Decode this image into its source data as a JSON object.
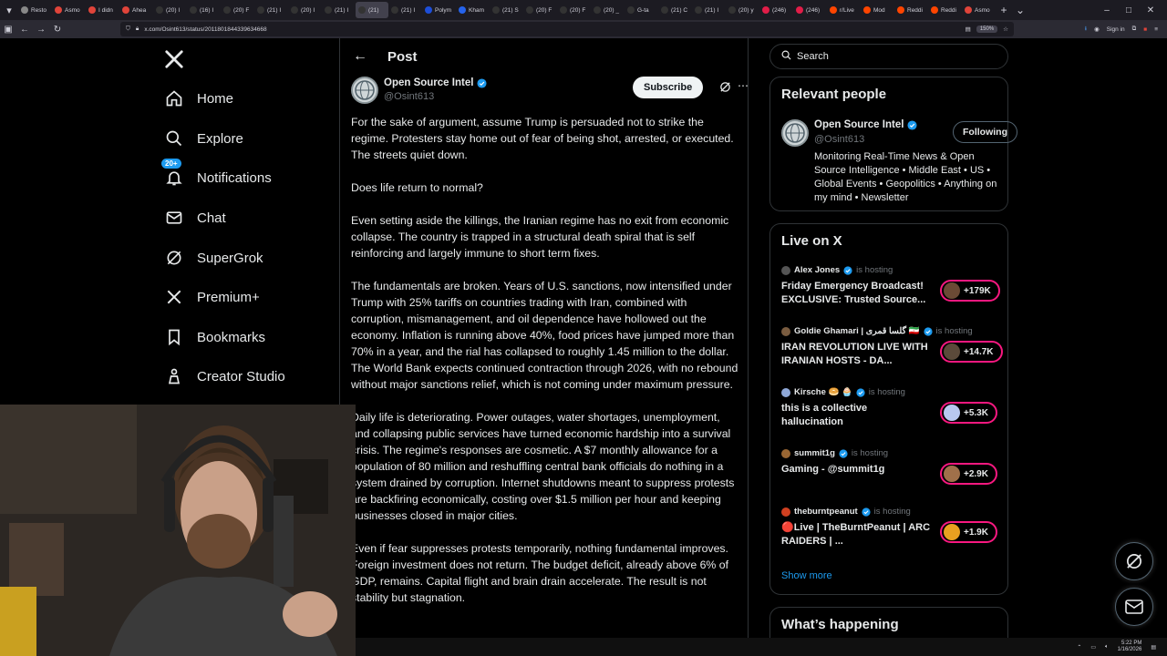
{
  "browser": {
    "tabs": [
      {
        "label": "Resto",
        "color": "#888888"
      },
      {
        "label": "Asmo",
        "color": "#e0443a"
      },
      {
        "label": "I didn",
        "color": "#e0443a"
      },
      {
        "label": "Ahea",
        "color": "#e0443a"
      },
      {
        "label": "(20) I",
        "color": "#333333"
      },
      {
        "label": "(16) I",
        "color": "#333333"
      },
      {
        "label": "(20) F",
        "color": "#333333"
      },
      {
        "label": "(21) I",
        "color": "#333333"
      },
      {
        "label": "(20) I",
        "color": "#333333"
      },
      {
        "label": "(21) I",
        "color": "#333333"
      },
      {
        "label": "(21)",
        "color": "#333333",
        "active": true
      },
      {
        "label": "(21) I",
        "color": "#333333"
      },
      {
        "label": "Polym",
        "color": "#1d4ed8"
      },
      {
        "label": "Kham",
        "color": "#2563eb"
      },
      {
        "label": "(21) S",
        "color": "#333333"
      },
      {
        "label": "(20) F",
        "color": "#333333"
      },
      {
        "label": "(20) F",
        "color": "#333333"
      },
      {
        "label": "(20) _",
        "color": "#333333"
      },
      {
        "label": "G-ta",
        "color": "#333333"
      },
      {
        "label": "(21) C",
        "color": "#333333"
      },
      {
        "label": "(21) I",
        "color": "#333333"
      },
      {
        "label": "(20) y",
        "color": "#333333"
      },
      {
        "label": "(246)",
        "color": "#e11d48"
      },
      {
        "label": "(246)",
        "color": "#e11d48"
      },
      {
        "label": "r/Live",
        "color": "#ff4500"
      },
      {
        "label": "Mod",
        "color": "#ff4500"
      },
      {
        "label": "Reddi",
        "color": "#ff4500"
      },
      {
        "label": "Reddi",
        "color": "#ff4500"
      },
      {
        "label": "Asmo",
        "color": "#e0443a"
      }
    ],
    "url": "x.com/Osint613/status/2011801844339634668",
    "zoom": "150%",
    "sign_in": "Sign in"
  },
  "sidebar": {
    "logo": "X",
    "items": [
      {
        "label": "Home",
        "icon": "home-icon"
      },
      {
        "label": "Explore",
        "icon": "search-icon"
      },
      {
        "label": "Notifications",
        "icon": "bell-icon",
        "badge": "20+"
      },
      {
        "label": "Chat",
        "icon": "mail-icon"
      },
      {
        "label": "SuperGrok",
        "icon": "grok-icon"
      },
      {
        "label": "Premium+",
        "icon": "x-icon"
      },
      {
        "label": "Bookmarks",
        "icon": "bookmark-icon"
      },
      {
        "label": "Creator Studio",
        "icon": "creator-icon"
      }
    ]
  },
  "post": {
    "header_title": "Post",
    "author_name": "Open Source Intel",
    "author_handle": "@Osint613",
    "subscribe_label": "Subscribe",
    "paragraphs": [
      "For the sake of argument, assume Trump is persuaded not to strike the regime. Protesters stay home out of fear of being shot, arrested, or executed. The streets quiet down.",
      "Does life return to normal?",
      "Even setting aside the killings, the Iranian regime has no exit from economic collapse. The country is trapped in a structural death spiral that is self reinforcing and largely immune to short term fixes.",
      "The fundamentals are broken. Years of U.S. sanctions, now intensified under Trump with 25% tariffs on countries trading with Iran, combined with corruption, mismanagement, and oil dependence have hollowed out the economy. Inflation is running above 40%, food prices have jumped more than 70% in a year, and the rial has collapsed to roughly 1.45 million to the dollar. The World Bank expects continued contraction through 2026, with no rebound without major sanctions relief, which is not coming under maximum pressure.",
      "Daily life is deteriorating. Power outages, water shortages, unemployment, and collapsing public services have turned economic hardship into a survival crisis. The regime's responses are cosmetic. A $7 monthly allowance for a population of 80 million and reshuffling central bank officials do nothing in a system drained by corruption. Internet shutdowns meant to suppress protests are backfiring economically, costing over $1.5 million per hour and keeping businesses closed in major cities.",
      "Even if fear suppresses protests temporarily, nothing fundamental improves. Foreign investment does not return. The budget deficit, already above 6% of GDP, remains. Capital flight and brain drain accelerate. The result is not stability but stagnation."
    ]
  },
  "right": {
    "search_placeholder": "Search",
    "relevant_title": "Relevant people",
    "relevant": {
      "name": "Open Source Intel",
      "handle": "@Osint613",
      "follow_label": "Following",
      "bio": "Monitoring Real-Time News & Open Source Intelligence • Middle East • US • Global Events • Geopolitics • Anything on my mind • Newsletter"
    },
    "live_title": "Live on X",
    "live": [
      {
        "host": "Alex Jones",
        "hosting": "is hosting",
        "title": "Friday Emergency Broadcast! EXCLUSIVE: Trusted Source...",
        "count": "+179K",
        "host_color": "#555555",
        "pill_color": "#6b4a35"
      },
      {
        "host": "Goldie Ghamari | گلسا قمری 🇮🇷",
        "hosting": "is hosting",
        "title": "IRAN REVOLUTION LIVE WITH IRANIAN HOSTS - DA...",
        "count": "+14.7K",
        "host_color": "#7a5c40",
        "pill_color": "#5b4a3a"
      },
      {
        "host": "Kirsche 🥯 🧁",
        "hosting": "is hosting",
        "title": "this is a collective hallucination",
        "count": "+5.3K",
        "host_color": "#8fa8d8",
        "pill_color": "#b8c8f0"
      },
      {
        "host": "summit1g",
        "hosting": "is hosting",
        "title": "Gaming - @summit1g",
        "count": "+2.9K",
        "host_color": "#996633",
        "pill_color": "#a0704a"
      },
      {
        "host": "theburntpeanut",
        "hosting": "is hosting",
        "title": "🔴Live | TheBurntPeanut | ARC RAIDERS | ...",
        "count": "+1.9K",
        "host_color": "#d04020",
        "pill_color": "#e8a020"
      }
    ],
    "show_more": "Show more",
    "happening_title": "What’s happening"
  },
  "taskbar": {
    "time": "5:22 PM",
    "date": "1/16/2026"
  },
  "colors": {
    "accent": "#1d9bf0",
    "live_pink": "#f91880",
    "border": "#2f3336"
  }
}
